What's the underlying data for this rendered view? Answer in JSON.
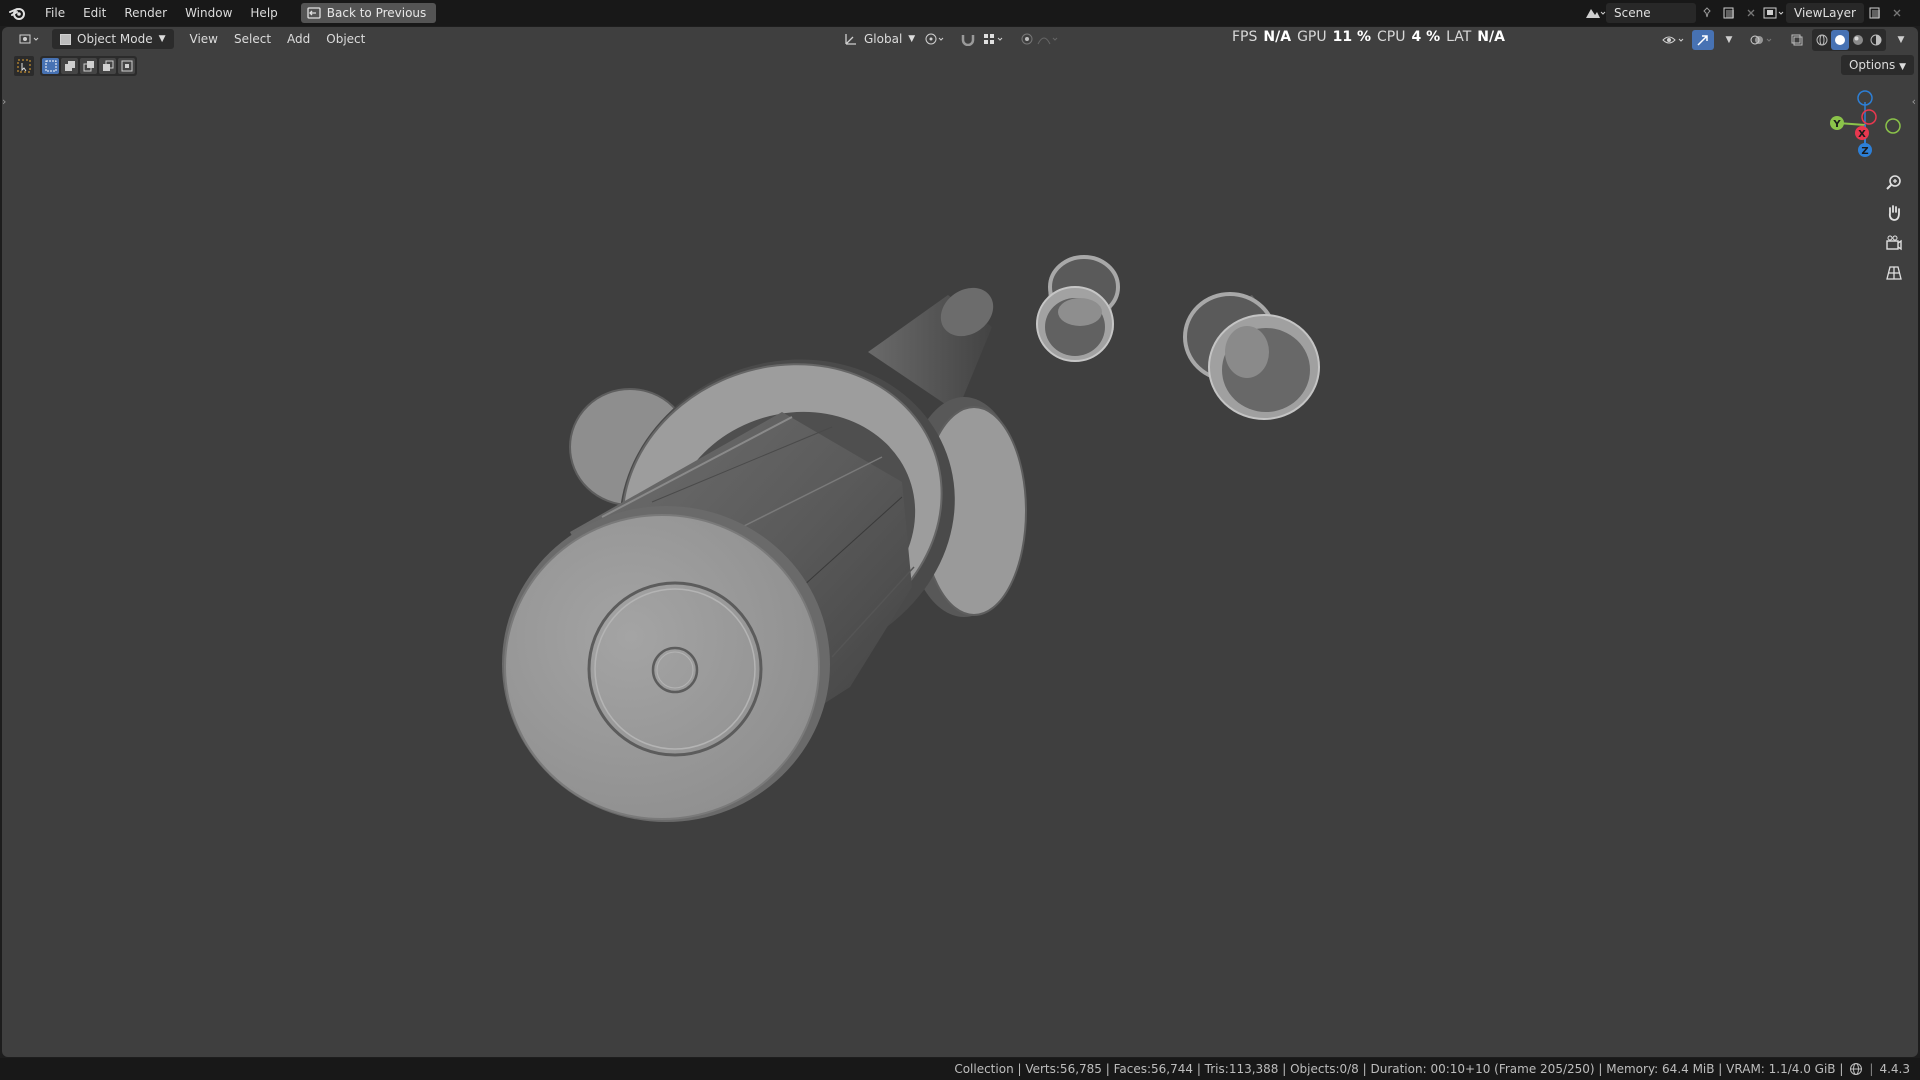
{
  "menu": {
    "items": [
      "File",
      "Edit",
      "Render",
      "Window",
      "Help"
    ],
    "back_label": "Back to Previous"
  },
  "scene": {
    "name": "Scene"
  },
  "view_layer": {
    "name": "ViewLayer"
  },
  "viewport_header": {
    "mode": "Object Mode",
    "menus": [
      "View",
      "Select",
      "Add",
      "Object"
    ],
    "transform_orientation": "Global"
  },
  "stats": {
    "fps_label": "FPS",
    "fps_value": "N/A",
    "gpu_label": "GPU",
    "gpu_value": "11 %",
    "cpu_label": "CPU",
    "cpu_value": "4 %",
    "lat_label": "LAT",
    "lat_value": "N/A"
  },
  "options_label": "Options",
  "gizmo": {
    "x_label": "X",
    "y_label": "Y",
    "z_label": "Z"
  },
  "status_bar": {
    "text": "Collection | Verts:56,785 | Faces:56,744 | Tris:113,388 | Objects:0/8 | Duration: 00:10+10 (Frame 205/250) | Memory: 64.4 MiB | VRAM: 1.1/4.0 GiB |",
    "version": "4.4.3"
  },
  "colors": {
    "viewport_bg": "#3f3f3f",
    "bar_bg": "#181818",
    "accent_blue": "#4772b3",
    "axis_x": "#e8384f",
    "axis_y": "#8bc34a",
    "axis_z": "#2d7fd6"
  }
}
